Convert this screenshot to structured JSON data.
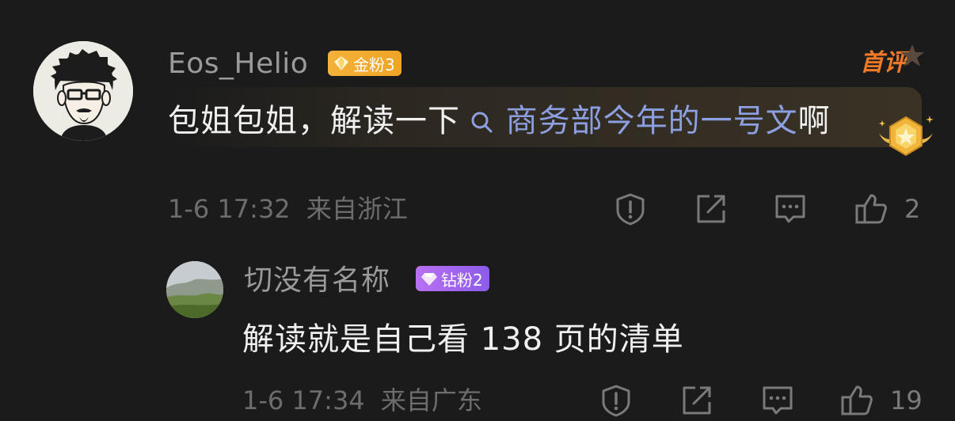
{
  "comment": {
    "username": "Eos_Helio",
    "badge": "金粉3",
    "first_tag": "首评",
    "text_prefix": "包姐包姐，解读一下",
    "link_text": "商务部今年的一号文",
    "text_suffix": "啊",
    "time": "1-6 17:32",
    "location": "来自浙江",
    "like_count": "2"
  },
  "reply": {
    "username": "切没有名称",
    "badge": "钻粉2",
    "text": "解读就是自己看 138 页的清单",
    "time": "1-6 17:34",
    "location": "来自广东",
    "like_count": "19"
  },
  "icons": {
    "report": "exclamation-shield-icon",
    "share": "share-arrow-icon",
    "reply": "chat-bubble-icon",
    "like": "thumbs-up-icon",
    "search": "search-icon",
    "first": "star-icon",
    "medal": "medal-icon"
  },
  "colors": {
    "background": "#1b1b1b",
    "gold_badge": "#f0a425",
    "purple_badge": "#9b60ef",
    "first_tag": "#f07a28",
    "link": "#8c9fe0"
  }
}
